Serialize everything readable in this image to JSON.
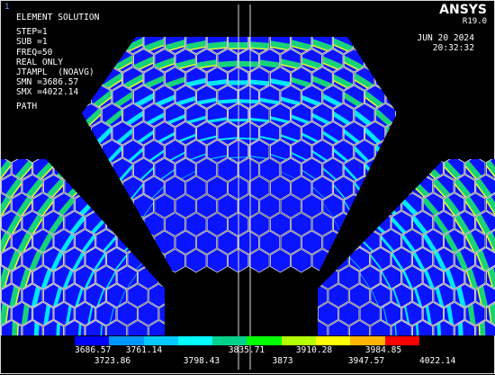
{
  "app": {
    "window_number": "1",
    "logo": "ANSYS",
    "version": "R19.0",
    "date": "JUN 20 2024",
    "time": "20:32:32"
  },
  "solution": {
    "title": "ELEMENT SOLUTION",
    "lines": [
      "STEP=1",
      "SUB =1",
      "FREQ=50",
      "REAL ONLY",
      "JTAMPL  (NOAVG)",
      "SMN =3686.57",
      "SMX =4022.14"
    ],
    "path_label": "PATH"
  },
  "legend": {
    "colors": [
      "#0000ff",
      "#0096ff",
      "#00c8ff",
      "#00ffff",
      "#00d28c",
      "#00ff00",
      "#b4ff00",
      "#ffff00",
      "#ffb400",
      "#ff0000"
    ],
    "top_labels": [
      "3686.57",
      "3761.14",
      "3835.71",
      "3910.28",
      "3984.85"
    ],
    "bottom_labels": [
      "3723.86",
      "3798.43",
      "3873",
      "3947.57",
      "4022.14"
    ]
  },
  "scene": {
    "colors": {
      "background": "#000000",
      "cell_base": "#0a14ff",
      "band_cyan": "#00e6ff",
      "band_green": "#18d27a",
      "band_yellow": "#ffff20",
      "band_orange": "#ff9a20",
      "outline": "#d9d9d9"
    }
  }
}
